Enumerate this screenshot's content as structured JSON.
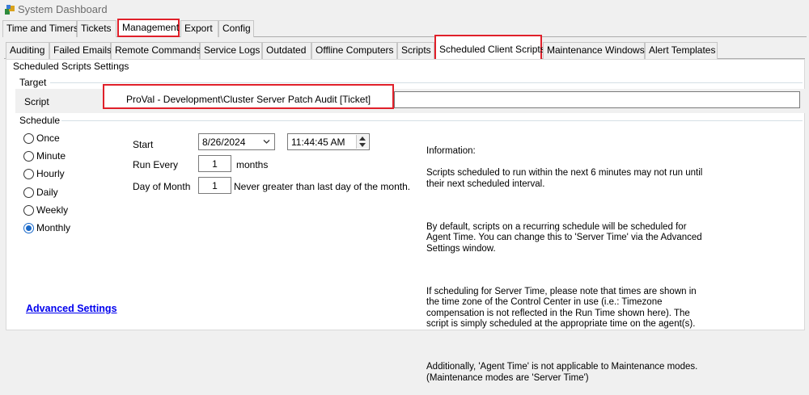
{
  "window": {
    "title": "System Dashboard"
  },
  "top_tabs": [
    "Time and Timers",
    "Tickets",
    "Management",
    "Export",
    "Config"
  ],
  "top_tabs_active": "Management",
  "sub_tabs": [
    "Auditing",
    "Failed Emails",
    "Remote Commands",
    "Service Logs",
    "Outdated",
    "Offline Computers",
    "Scripts",
    "Scheduled Client Scripts",
    "Maintenance Windows",
    "Alert Templates"
  ],
  "sub_tabs_active": "Scheduled Client Scripts",
  "section_title": "Scheduled Scripts Settings",
  "target": {
    "group_label": "Target",
    "script_label": "Script",
    "script_value": "ProVal - Development\\Cluster Server Patch Audit [Ticket]"
  },
  "schedule": {
    "group_label": "Schedule",
    "options": [
      "Once",
      "Minute",
      "Hourly",
      "Daily",
      "Weekly",
      "Monthly"
    ],
    "selected": "Monthly",
    "start_label": "Start",
    "start_date": "8/26/2024",
    "start_time": "11:44:45 AM",
    "run_every_label": "Run Every",
    "run_every_value": "1",
    "run_every_unit": "months",
    "day_of_month_label": "Day of Month",
    "day_of_month_value": "1",
    "day_of_month_note": "Never greater than last day of the month."
  },
  "information": {
    "heading": "Information:",
    "p1": "Scripts scheduled to run within the next 6 minutes may not run until\ntheir next scheduled interval.",
    "p2": "By default, scripts on a recurring schedule will be scheduled for\nAgent Time. You can change this to 'Server Time' via the Advanced\nSettings window.",
    "p3": "If scheduling for Server Time, please note that times are shown in\nthe time zone of the Control Center in use (i.e.: Timezone\ncompensation is not reflected in the Run Time shown here). The\nscript is simply scheduled at the appropriate time on the agent(s).",
    "p4": "Additionally, 'Agent Time' is not applicable to Maintenance modes.\n(Maintenance modes are 'Server Time')"
  },
  "advanced_link": "Advanced Settings",
  "colors": {
    "highlight": "#e0202a",
    "link": "#0000ee",
    "radio": "#1b6ac9"
  }
}
